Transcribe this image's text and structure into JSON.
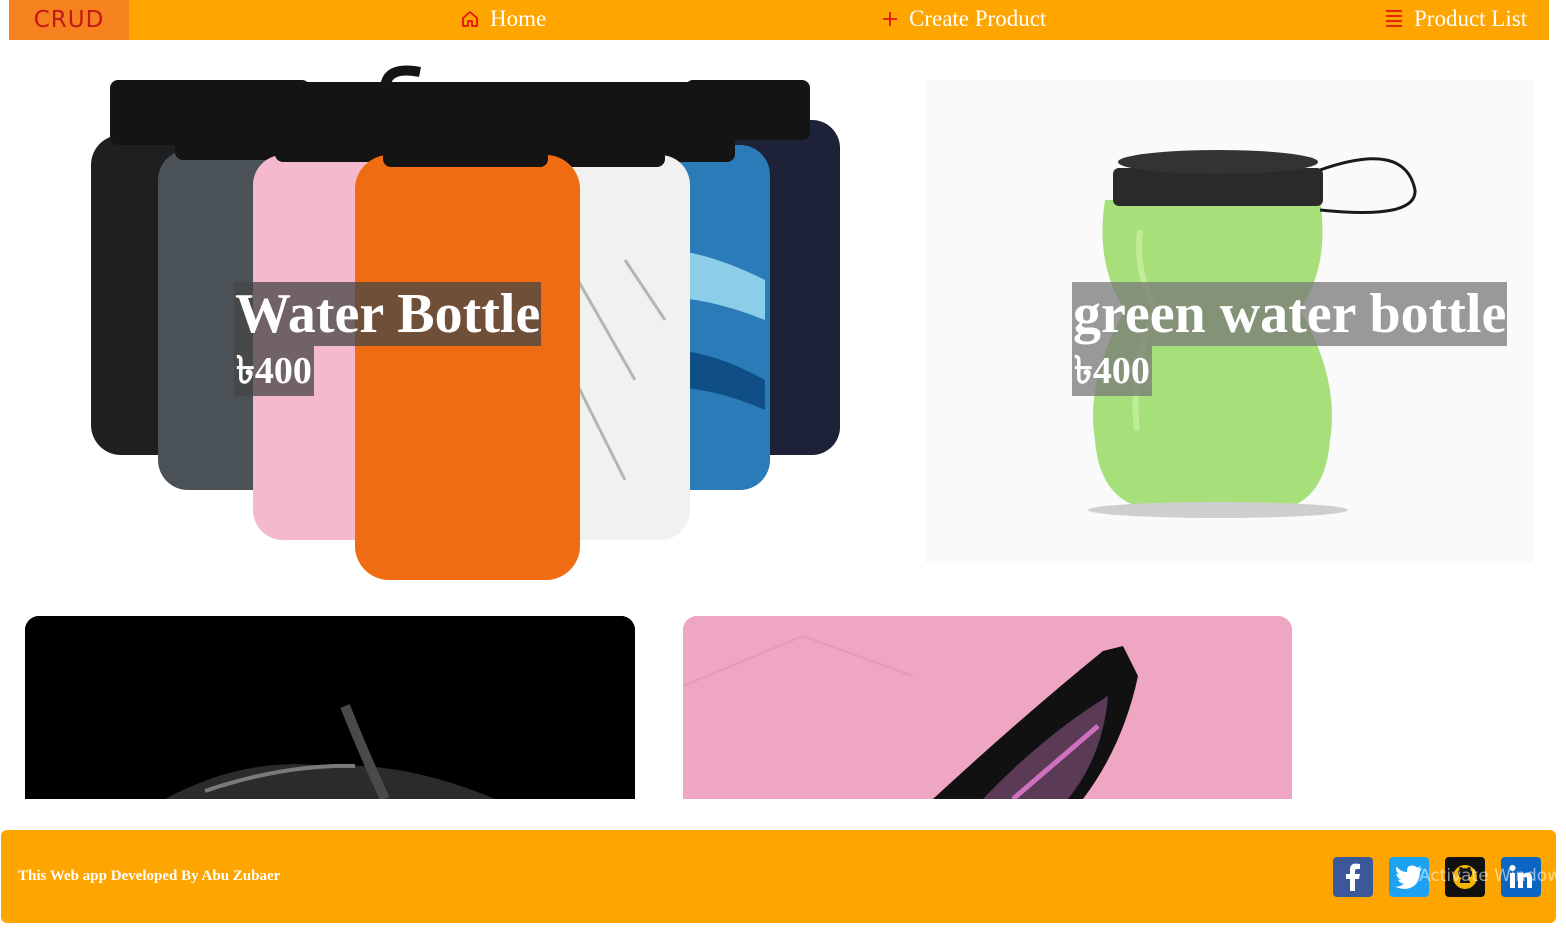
{
  "nav": {
    "logo": "CRUD",
    "home": "Home",
    "create": "Create Product",
    "list": "Product List"
  },
  "products": [
    {
      "name": "Water Bottle",
      "price": "৳400"
    },
    {
      "name": "green water bottle",
      "price": "৳400"
    }
  ],
  "footer": {
    "credit": "This Web app Developed By Abu Zubaer",
    "social": [
      "facebook-icon",
      "twitter-icon",
      "github-icon",
      "linkedin-icon"
    ],
    "watermark": "Activate Window"
  },
  "colors": {
    "header_bg": "#ffa500",
    "logo_bg": "#f5821f",
    "icon_red": "#e31212",
    "footer_bg": "#ffa500"
  }
}
